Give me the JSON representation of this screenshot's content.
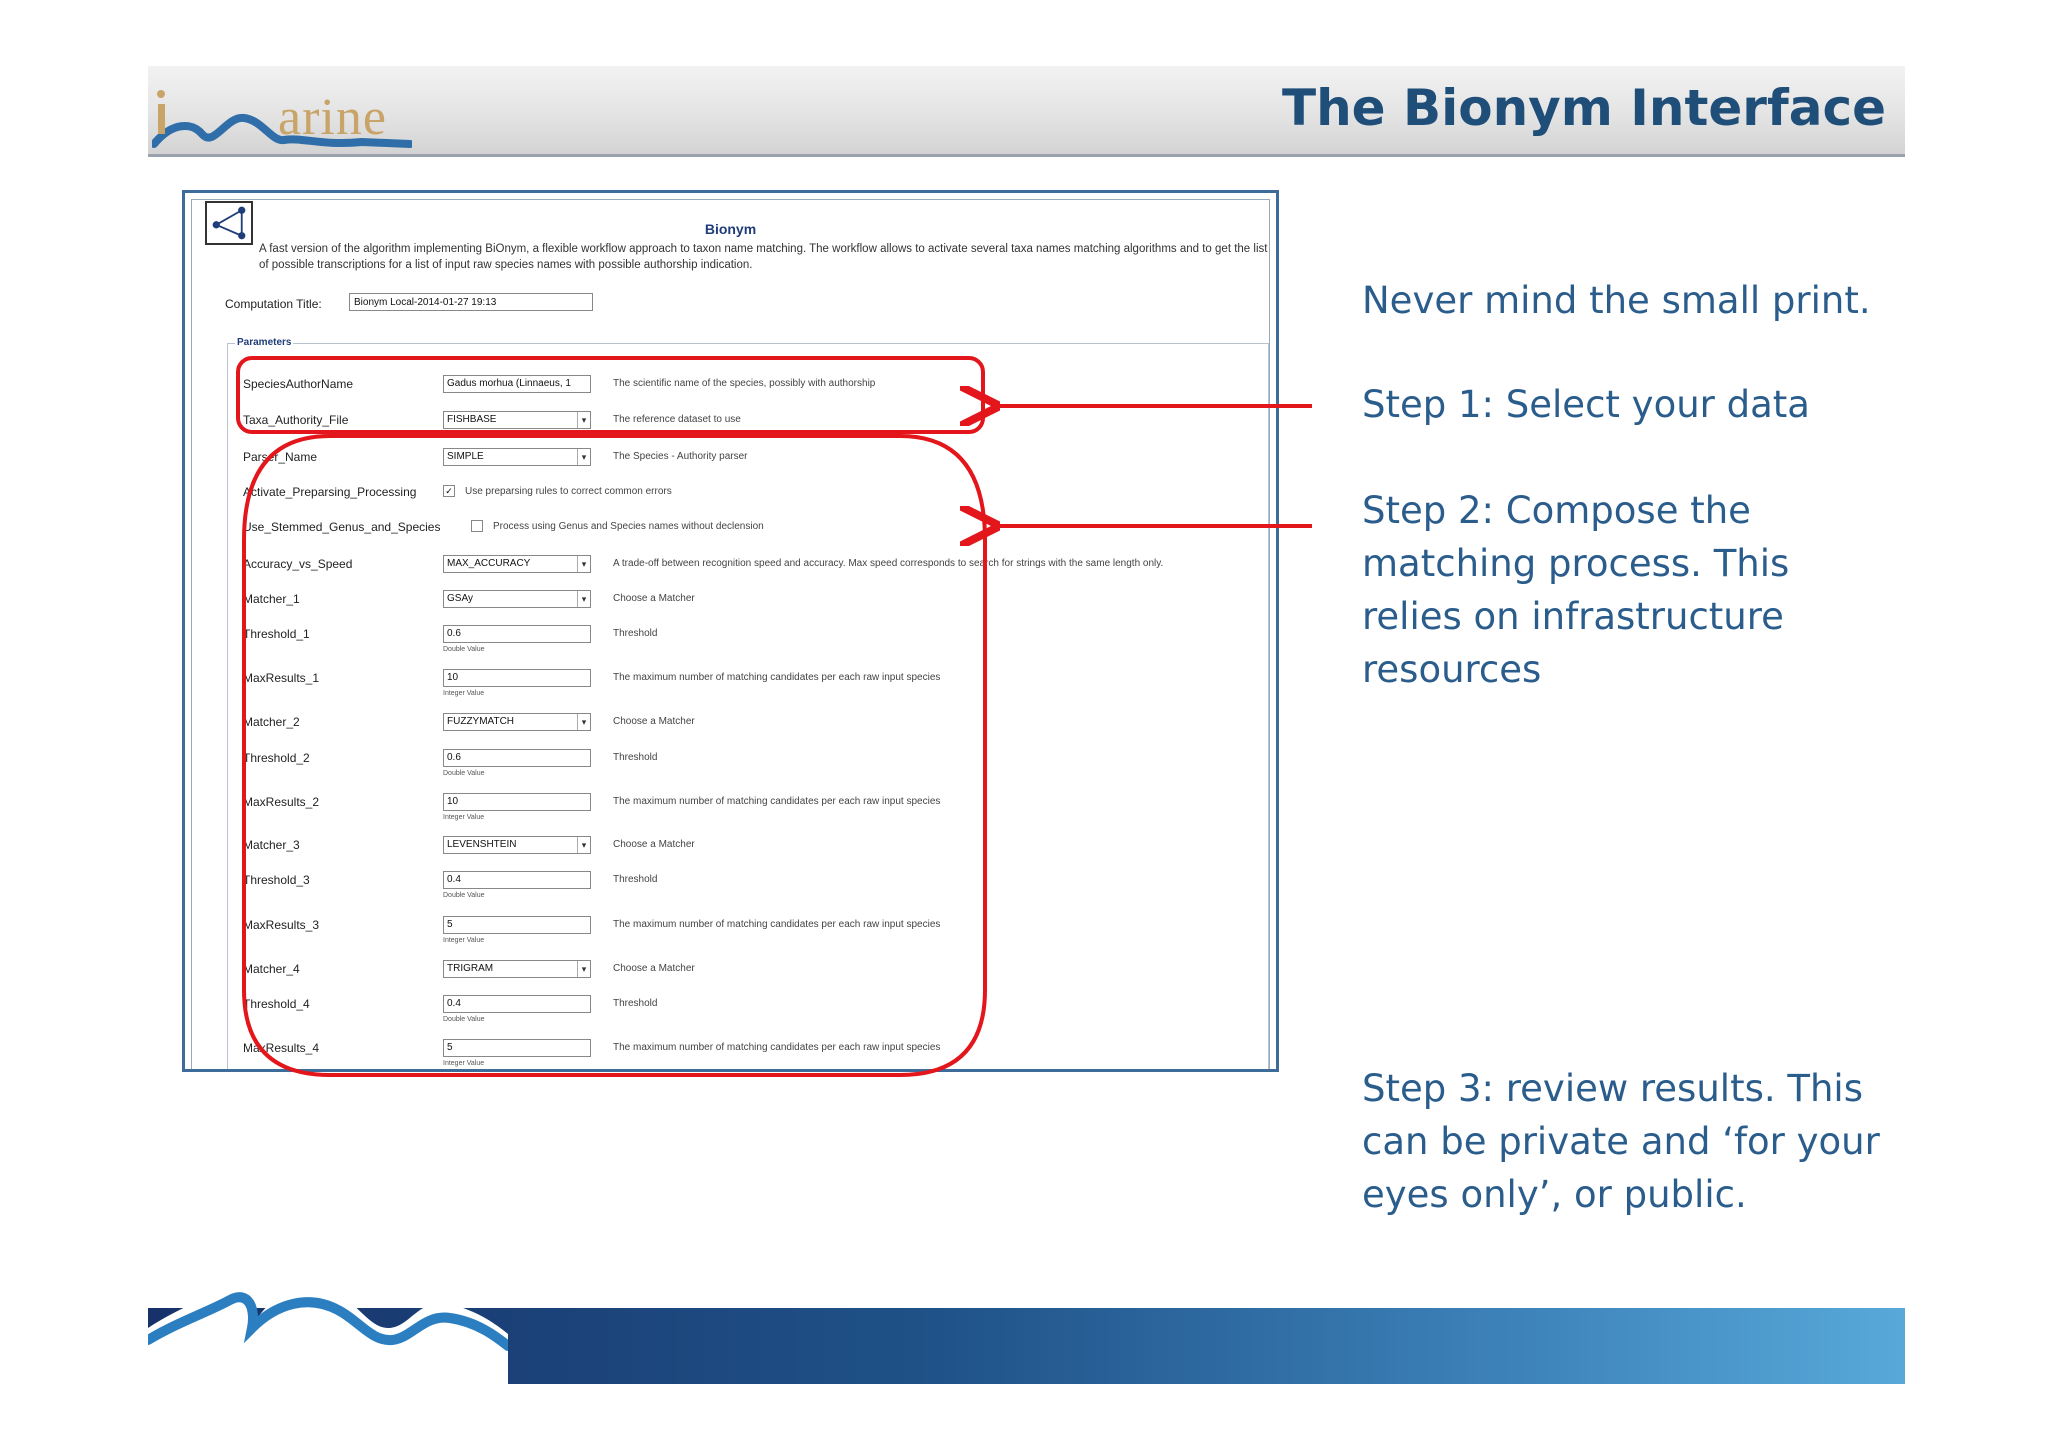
{
  "header": {
    "logo_text": "arine",
    "title": "The Bionym Interface"
  },
  "notes": [
    "Never mind the small print.",
    "Step 1: Select your data",
    "Step 2: Compose the matching process. This relies on infrastructure resources",
    "Step 3: review results. This can be private and ‘for your eyes only’, or public."
  ],
  "screenshot": {
    "title": "Bionym",
    "description": "A fast version of the algorithm implementing BiOnym, a flexible workflow approach to taxon name matching. The workflow allows to activate several taxa names matching algorithms and to get the list of possible transcriptions for a list of input raw species names with possible authorship indication.",
    "computation_label": "Computation Title:",
    "computation_value": "Bionym Local-2014-01-27 19:13",
    "parameters_legend": "Parameters",
    "rows": [
      {
        "label": "SpeciesAuthorName",
        "value": "Gadus morhua (Linnaeus, 1",
        "hint": "The scientific name of the species, possibly with authorship",
        "kind": "input"
      },
      {
        "label": "Taxa_Authority_File",
        "value": "FISHBASE",
        "hint": "The reference dataset to use",
        "kind": "select"
      },
      {
        "label": "Parser_Name",
        "value": "SIMPLE",
        "hint": "The Species - Authority parser",
        "kind": "select"
      },
      {
        "label": "Activate_Preparsing_Processing",
        "hint": "Use preparsing rules to correct common errors",
        "kind": "check",
        "checked": "✓"
      },
      {
        "label": "Use_Stemmed_Genus_and_Species",
        "hint": "Process using Genus and Species names without declension",
        "kind": "check",
        "checked": ""
      },
      {
        "label": "Accuracy_vs_Speed",
        "value": "MAX_ACCURACY",
        "hint": "A trade-off between recognition speed and accuracy. Max speed corresponds to search for strings with the same length only.",
        "kind": "select"
      },
      {
        "label": "Matcher_1",
        "value": "GSAy",
        "hint": "Choose a Matcher",
        "kind": "select"
      },
      {
        "label": "Threshold_1",
        "value": "0.6",
        "hint": "Threshold",
        "kind": "input",
        "sub": "Double Value"
      },
      {
        "label": "MaxResults_1",
        "value": "10",
        "hint": "The maximum number of matching candidates per each raw input species",
        "kind": "input",
        "sub": "Integer Value"
      },
      {
        "label": "Matcher_2",
        "value": "FUZZYMATCH",
        "hint": "Choose a Matcher",
        "kind": "select"
      },
      {
        "label": "Threshold_2",
        "value": "0.6",
        "hint": "Threshold",
        "kind": "input",
        "sub": "Double Value"
      },
      {
        "label": "MaxResults_2",
        "value": "10",
        "hint": "The maximum number of matching candidates per each raw input species",
        "kind": "input",
        "sub": "Integer Value"
      },
      {
        "label": "Matcher_3",
        "value": "LEVENSHTEIN",
        "hint": "Choose a Matcher",
        "kind": "select"
      },
      {
        "label": "Threshold_3",
        "value": "0.4",
        "hint": "Threshold",
        "kind": "input",
        "sub": "Double Value"
      },
      {
        "label": "MaxResults_3",
        "value": "5",
        "hint": "The maximum number of matching candidates per each raw input species",
        "kind": "input",
        "sub": "Integer Value"
      },
      {
        "label": "Matcher_4",
        "value": "TRIGRAM",
        "hint": "Choose a Matcher",
        "kind": "select"
      },
      {
        "label": "Threshold_4",
        "value": "0.4",
        "hint": "Threshold",
        "kind": "input",
        "sub": "Double Value"
      },
      {
        "label": "MaxResults_4",
        "value": "5",
        "hint": "The maximum number of matching candidates per each raw input species",
        "kind": "input",
        "sub": "Integer Value"
      }
    ]
  },
  "colors": {
    "title_blue": "#1f4e79",
    "note_blue": "#2b5d8c",
    "annotation_red": "#e3161b",
    "footer_dark": "#17326a",
    "footer_light": "#58a9d9"
  },
  "icons": {
    "logo": "wave-logo-icon",
    "app": "network-graph-icon",
    "dropdown": "chevron-down-icon"
  }
}
